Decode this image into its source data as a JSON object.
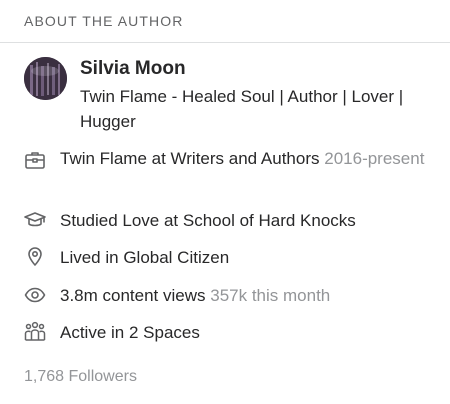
{
  "section": {
    "title": "ABOUT THE AUTHOR"
  },
  "profile": {
    "name": "Silvia Moon",
    "tagline": "Twin Flame - Healed Soul | Author | Lover | Hugger"
  },
  "credentials": {
    "employment": {
      "text": "Twin Flame at Writers and Authors",
      "years": "2016-present",
      "icon": "briefcase-icon"
    },
    "education": {
      "text": "Studied Love at School of Hard Knocks",
      "icon": "graduation-cap-icon"
    },
    "location": {
      "text": "Lived in Global Citizen",
      "icon": "location-pin-icon"
    },
    "views": {
      "text": "3.8m content views",
      "extra": "357k this month",
      "icon": "eye-icon"
    },
    "spaces": {
      "text": "Active in 2 Spaces",
      "icon": "people-group-icon"
    }
  },
  "followers": {
    "text": "1,768 Followers"
  }
}
